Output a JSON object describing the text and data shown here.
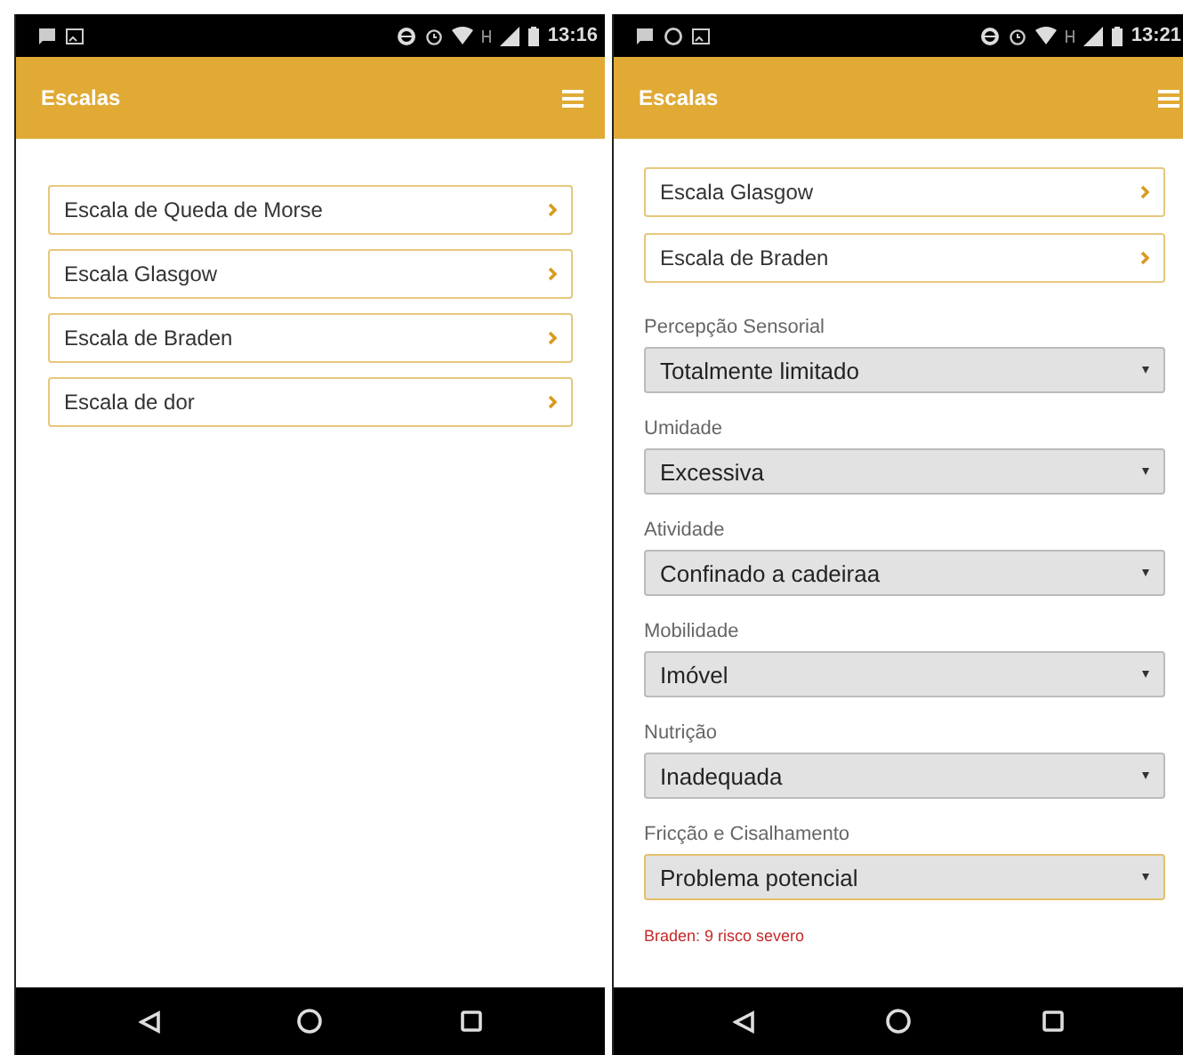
{
  "phones": [
    {
      "status_bar": {
        "time": "13:16",
        "notifications": [
          {
            "kind": "message"
          },
          {
            "kind": "image"
          }
        ]
      },
      "app_bar": {
        "title": "Escalas"
      },
      "scale_list": [
        "Escala de Queda de Morse",
        "Escala Glasgow",
        "Escala de Braden",
        "Escala de dor"
      ]
    },
    {
      "status_bar": {
        "time": "13:21",
        "notifications": [
          {
            "kind": "message"
          },
          {
            "kind": "whatsapp"
          },
          {
            "kind": "image"
          }
        ]
      },
      "app_bar": {
        "title": "Escalas"
      },
      "scale_list": [
        "Escala Glasgow",
        "Escala de Braden"
      ],
      "fields": [
        {
          "label": "Percepção Sensorial",
          "value": "Totalmente limitado",
          "focused": false
        },
        {
          "label": "Umidade",
          "value": "Excessiva",
          "focused": false
        },
        {
          "label": "Atividade",
          "value": "Confinado a cadeiraa",
          "focused": false
        },
        {
          "label": "Mobilidade",
          "value": "Imóvel",
          "focused": false
        },
        {
          "label": "Nutrição",
          "value": "Inadequada",
          "focused": false
        },
        {
          "label": "Fricção e Cisalhamento",
          "value": "Problema potencial",
          "focused": true
        }
      ],
      "result": "Braden: 9 risco severo"
    }
  ]
}
